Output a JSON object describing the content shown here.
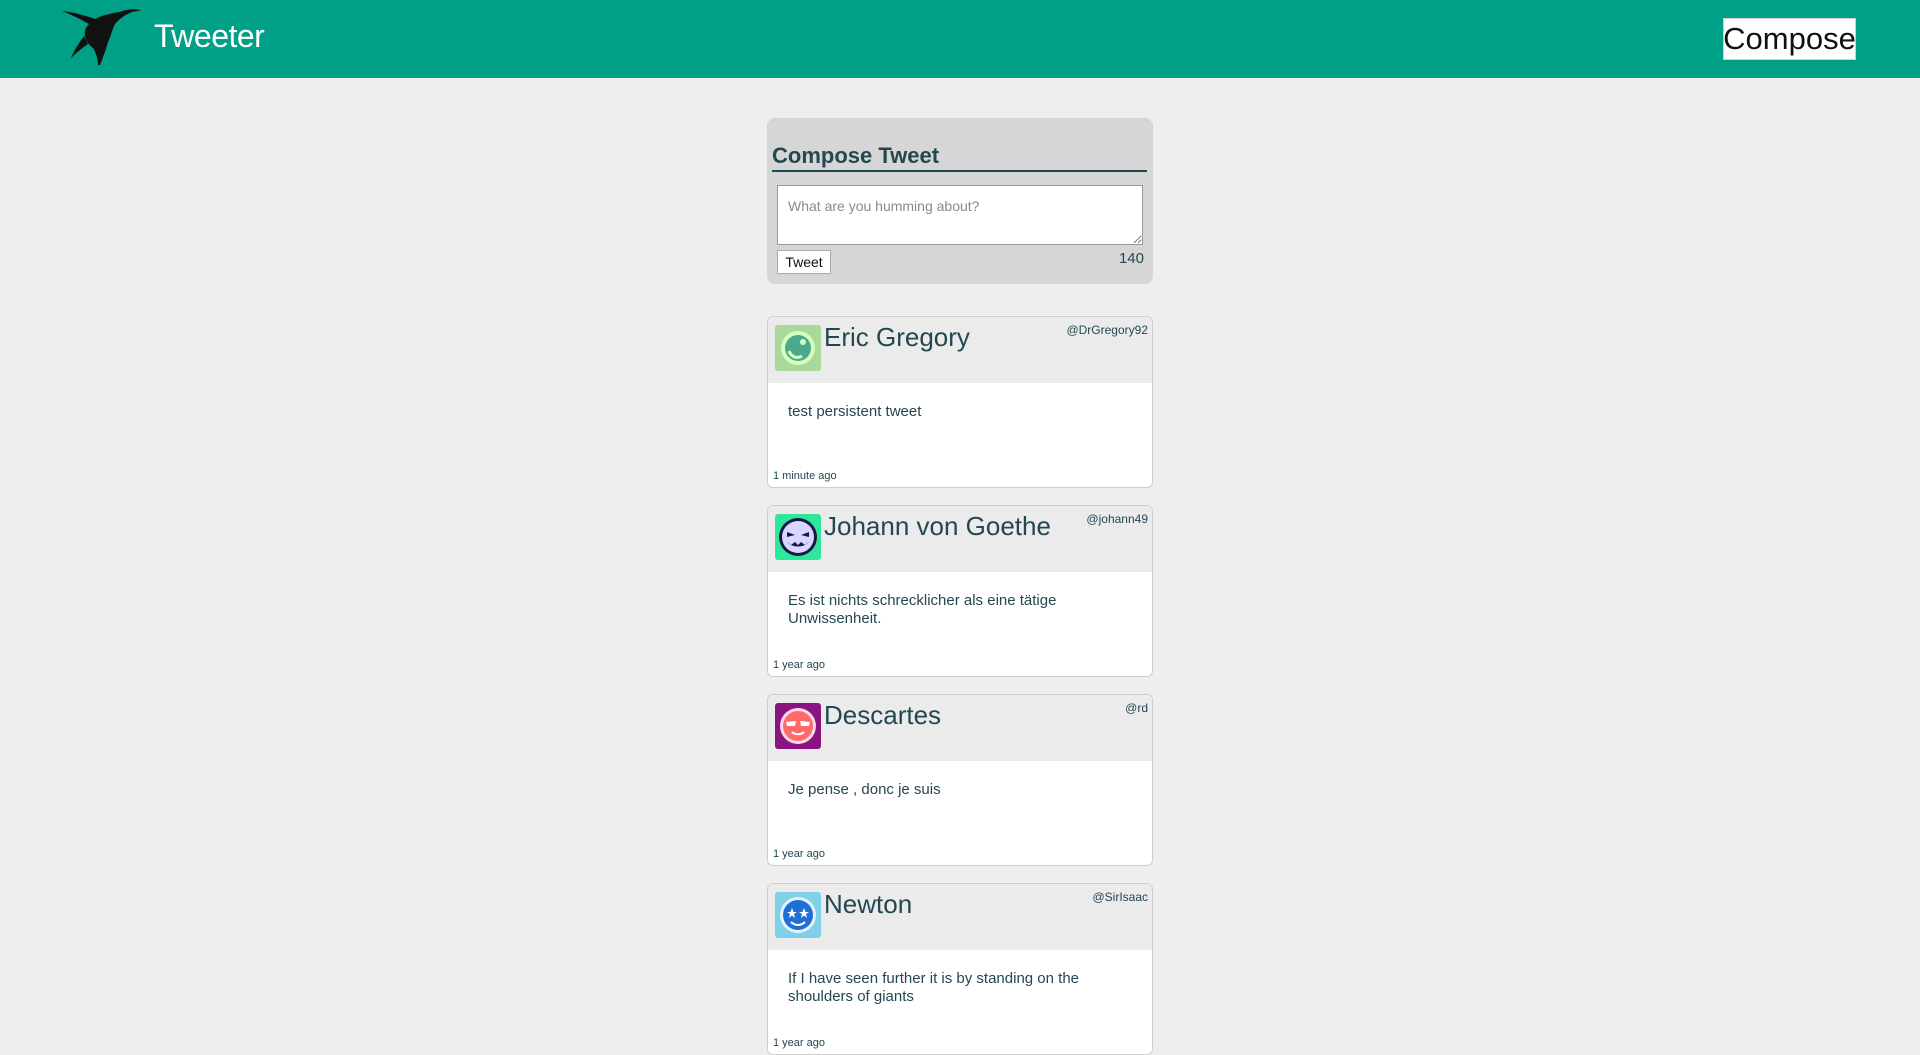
{
  "header": {
    "brand": "Tweeter",
    "compose_label": "Compose"
  },
  "compose": {
    "title": "Compose Tweet",
    "placeholder": "What are you humming about?",
    "tweet_button": "Tweet",
    "counter": "140"
  },
  "tweets": [
    {
      "name": "Eric Gregory",
      "handle": "@DrGregory92",
      "text": "test persistent tweet",
      "time": "1 minute ago",
      "avatar_bg": "#a9d89a",
      "avatar_fg": "#2d6b45"
    },
    {
      "name": "Johann von Goethe",
      "handle": "@johann49",
      "text": "Es ist nichts schrecklicher als eine tätige Unwissenheit.",
      "time": "1 year ago",
      "avatar_bg": "#2ee89a",
      "avatar_fg": "#17184a"
    },
    {
      "name": "Descartes",
      "handle": "@rd",
      "text": "Je pense , donc je suis",
      "time": "1 year ago",
      "avatar_bg": "#8a1580",
      "avatar_fg": "#ff6a6a"
    },
    {
      "name": "Newton",
      "handle": "@SirIsaac",
      "text": "If I have seen further it is by standing on the shoulders of giants",
      "time": "1 year ago",
      "avatar_bg": "#7fd0e8",
      "avatar_fg": "#1f6fd6"
    }
  ],
  "colors": {
    "header_bg": "#00a087",
    "page_bg": "#eeeeee",
    "text": "#244751"
  }
}
